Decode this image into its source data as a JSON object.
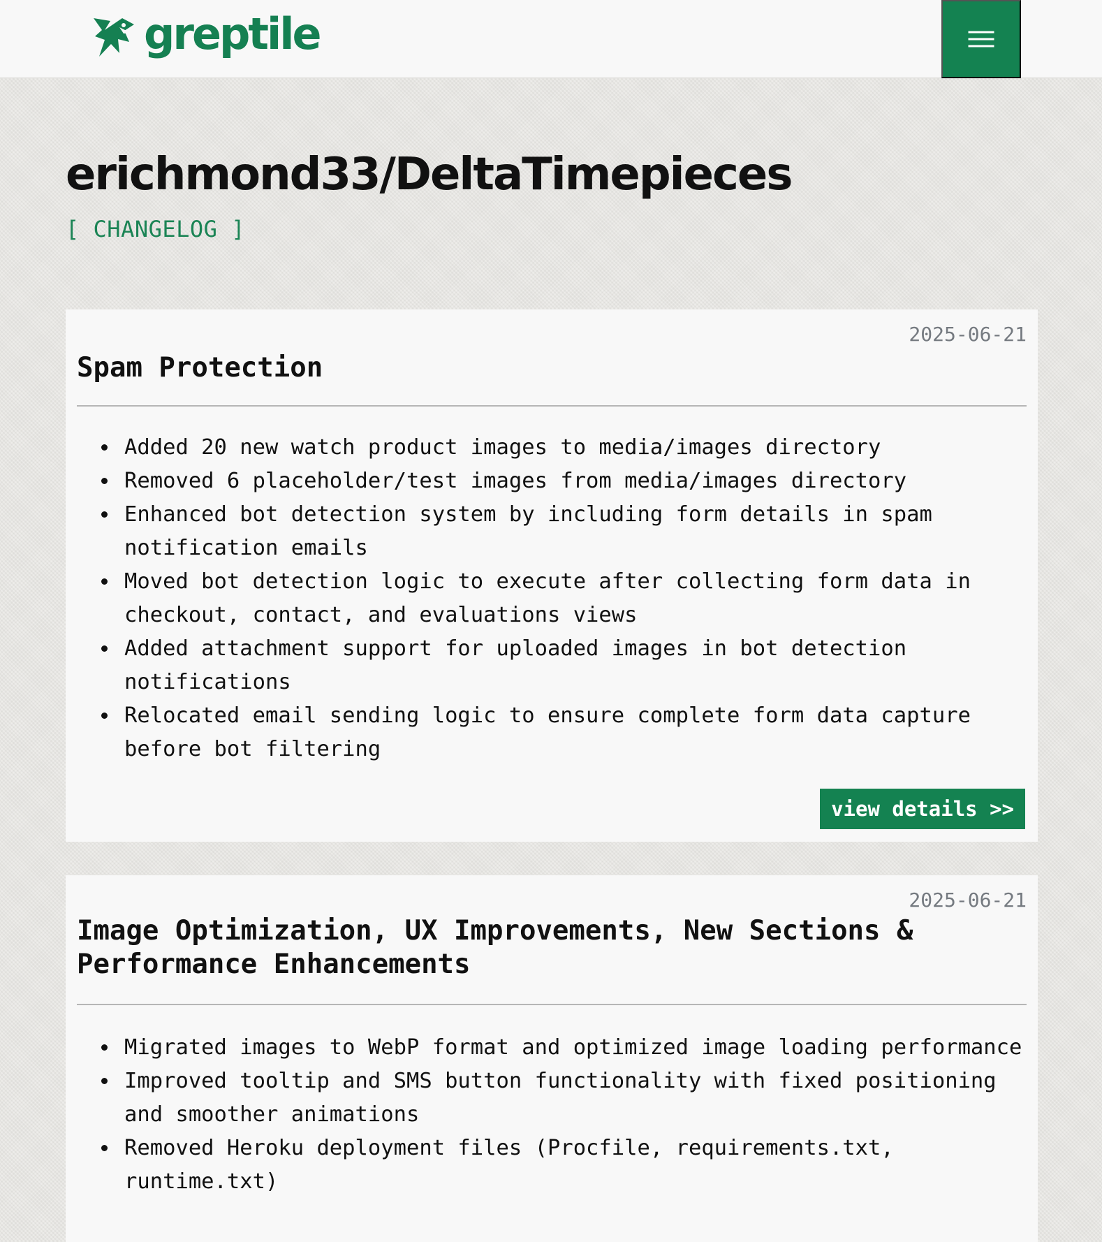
{
  "colors": {
    "brand_green": "#158052",
    "page_background": "#e7e6e2",
    "panel_background": "#f8f8f8",
    "muted_date": "#757a80",
    "divider": "#b6b6b6"
  },
  "header": {
    "logo_icon": "greptile-lizard-icon",
    "logo_text": "greptile",
    "menu_icon": "hamburger-menu-icon"
  },
  "page": {
    "title": "erichmond33/DeltaTimepieces",
    "subtitle": "[ CHANGELOG ]"
  },
  "changelog": {
    "entries": [
      {
        "date": "2025-06-21",
        "title": "Spam Protection",
        "items": [
          "Added 20 new watch product images to media/images directory",
          "Removed 6 placeholder/test images from media/images directory",
          "Enhanced bot detection system by including form details in spam notification emails",
          "Moved bot detection logic to execute after collecting form data in checkout, contact, and evaluations views",
          "Added attachment support for uploaded images in bot detection notifications",
          "Relocated email sending logic to ensure complete form data capture before bot filtering"
        ],
        "button_label": "view details >>"
      },
      {
        "date": "2025-06-21",
        "title": "Image Optimization, UX Improvements, New Sections & Performance Enhancements",
        "items": [
          "Migrated images to WebP format and optimized image loading performance",
          "Improved tooltip and SMS button functionality with fixed positioning and smoother animations",
          "Removed Heroku deployment files (Procfile, requirements.txt, runtime.txt)"
        ]
      }
    ]
  }
}
